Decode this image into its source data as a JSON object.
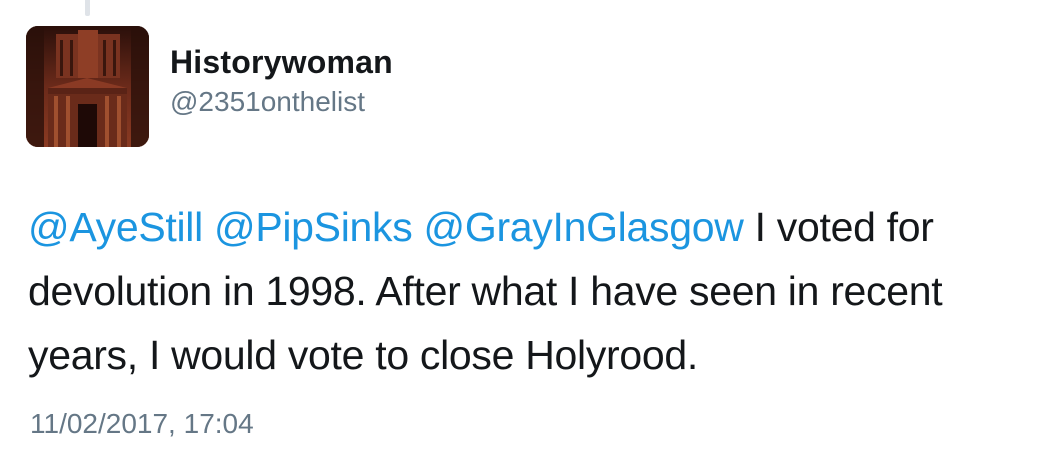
{
  "tweet": {
    "author": {
      "display_name": "Historywoman",
      "handle": "@2351onthelist",
      "avatar_icon": "petra-treasury-photo"
    },
    "mentions": [
      "@AyeStill",
      "@PipSinks",
      "@GrayInGlasgow"
    ],
    "text_line1": "I voted for",
    "text_line2": "devolution in 1998. After what I have seen in recent",
    "text_line3": "years, I would vote to close Holyrood.",
    "timestamp": "11/02/2017, 17:04"
  },
  "colors": {
    "link": "#1b95e0",
    "text": "#14171a",
    "secondary": "#657786",
    "thread_line": "#dfe3e8"
  }
}
